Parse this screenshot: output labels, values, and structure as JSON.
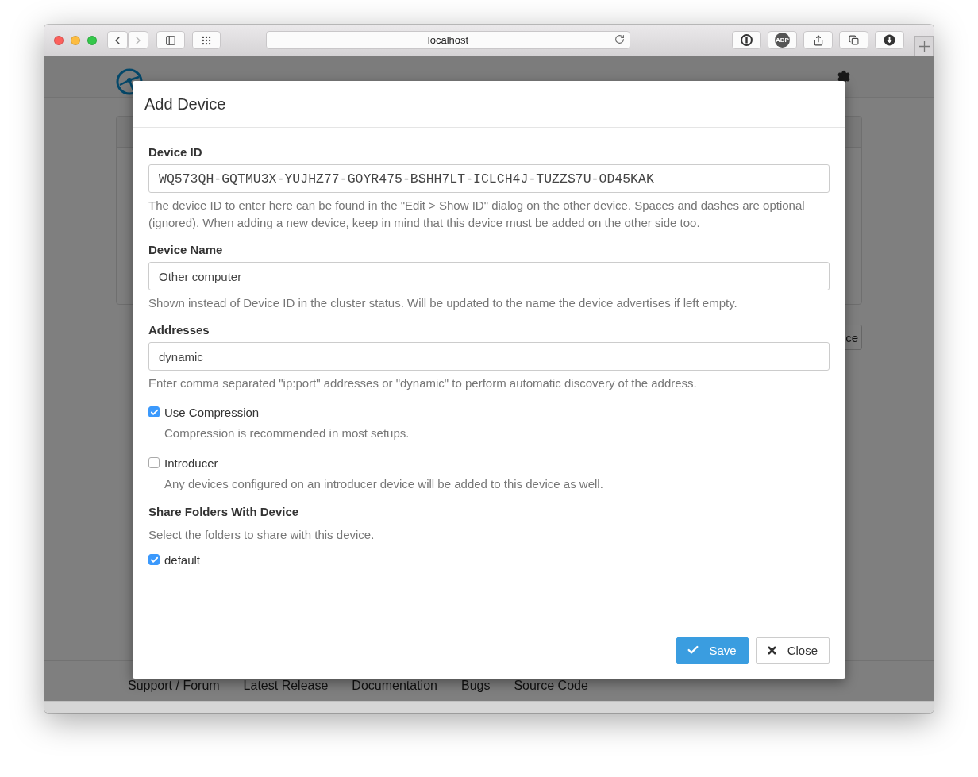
{
  "browser": {
    "address": "localhost",
    "adblock_label": "ABP"
  },
  "background_page": {
    "button_fragment": "ce",
    "footer_links": [
      "Support / Forum",
      "Latest Release",
      "Documentation",
      "Bugs",
      "Source Code"
    ]
  },
  "dialog": {
    "title": "Add Device",
    "fields": [
      {
        "label": "Device ID",
        "value": "WQ573QH-GQTMU3X-YUJHZ77-GOYR475-BSHH7LT-ICLCH4J-TUZZS7U-OD45KAK",
        "kind": "mono",
        "help": "The device ID to enter here can be found in the \"Edit > Show ID\" dialog on the other device. Spaces and dashes are optional (ignored). When adding a new device, keep in mind that this device must be added on the other side too."
      },
      {
        "label": "Device Name",
        "value": "Other computer",
        "kind": "text",
        "help": "Shown instead of Device ID in the cluster status. Will be updated to the name the device advertises if left empty."
      },
      {
        "label": "Addresses",
        "value": "dynamic",
        "kind": "text",
        "help": "Enter comma separated \"ip:port\" addresses or \"dynamic\" to perform automatic discovery of the address."
      }
    ],
    "options": [
      {
        "label": "Use Compression",
        "checked": true,
        "help": "Compression is recommended in most setups."
      },
      {
        "label": "Introducer",
        "checked": false,
        "help": "Any devices configured on an introducer device will be added to this device as well."
      }
    ],
    "share": {
      "title": "Share Folders With Device",
      "help": "Select the folders to share with this device.",
      "folders": [
        {
          "label": "default",
          "checked": true
        }
      ]
    },
    "buttons": [
      {
        "label": "Save",
        "kind": "primary"
      },
      {
        "label": "Close",
        "kind": "default"
      }
    ]
  }
}
